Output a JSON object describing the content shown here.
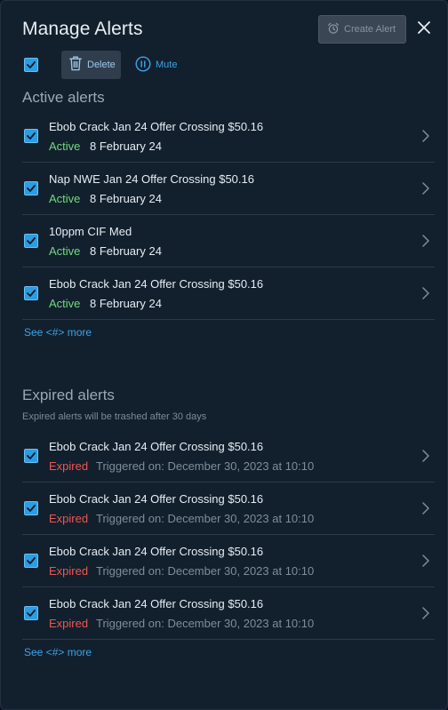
{
  "header": {
    "title": "Manage Alerts",
    "create_alert_label": "Create Alert"
  },
  "toolbar": {
    "delete_label": "Delete",
    "mute_label": "Mute"
  },
  "active": {
    "title": "Active alerts",
    "see_more": "See <#> more",
    "items": [
      {
        "name": "Ebob Crack Jan 24 Offer Crossing $50.16",
        "status": "Active",
        "date": "8 February 24"
      },
      {
        "name": "Nap NWE Jan 24 Offer Crossing $50.16",
        "status": "Active",
        "date": "8 February 24"
      },
      {
        "name": "10ppm CIF Med",
        "status": "Active",
        "date": "8 February 24"
      },
      {
        "name": "Ebob Crack Jan 24 Offer Crossing $50.16",
        "status": "Active",
        "date": "8 February 24"
      }
    ]
  },
  "expired": {
    "title": "Expired alerts",
    "subtitle": "Expired alerts will be trashed after 30 days",
    "see_more": "See <#> more",
    "items": [
      {
        "name": "Ebob Crack Jan 24 Offer Crossing $50.16",
        "status": "Expired",
        "triggered": "Triggered on: December 30, 2023 at 10:10"
      },
      {
        "name": "Ebob Crack Jan 24 Offer Crossing $50.16",
        "status": "Expired",
        "triggered": "Triggered on: December 30, 2023 at 10:10"
      },
      {
        "name": "Ebob Crack Jan 24 Offer Crossing $50.16",
        "status": "Expired",
        "triggered": "Triggered on: December 30, 2023 at 10:10"
      },
      {
        "name": "Ebob Crack Jan 24 Offer Crossing $50.16",
        "status": "Expired",
        "triggered": "Triggered on: December 30, 2023 at 10:10"
      }
    ]
  },
  "colors": {
    "background": "#12202e",
    "accent": "#2b9de3",
    "active_status": "#6fdc7a",
    "expired_status": "#f0554f",
    "link": "#3aa4e8"
  },
  "icons": {
    "create_alert": "alarm-clock-icon",
    "close": "close-icon",
    "delete": "trash-icon",
    "mute": "pause-circle-icon",
    "row_chevron": "chevron-right-icon",
    "checkbox": "checkbox-checked-icon"
  }
}
